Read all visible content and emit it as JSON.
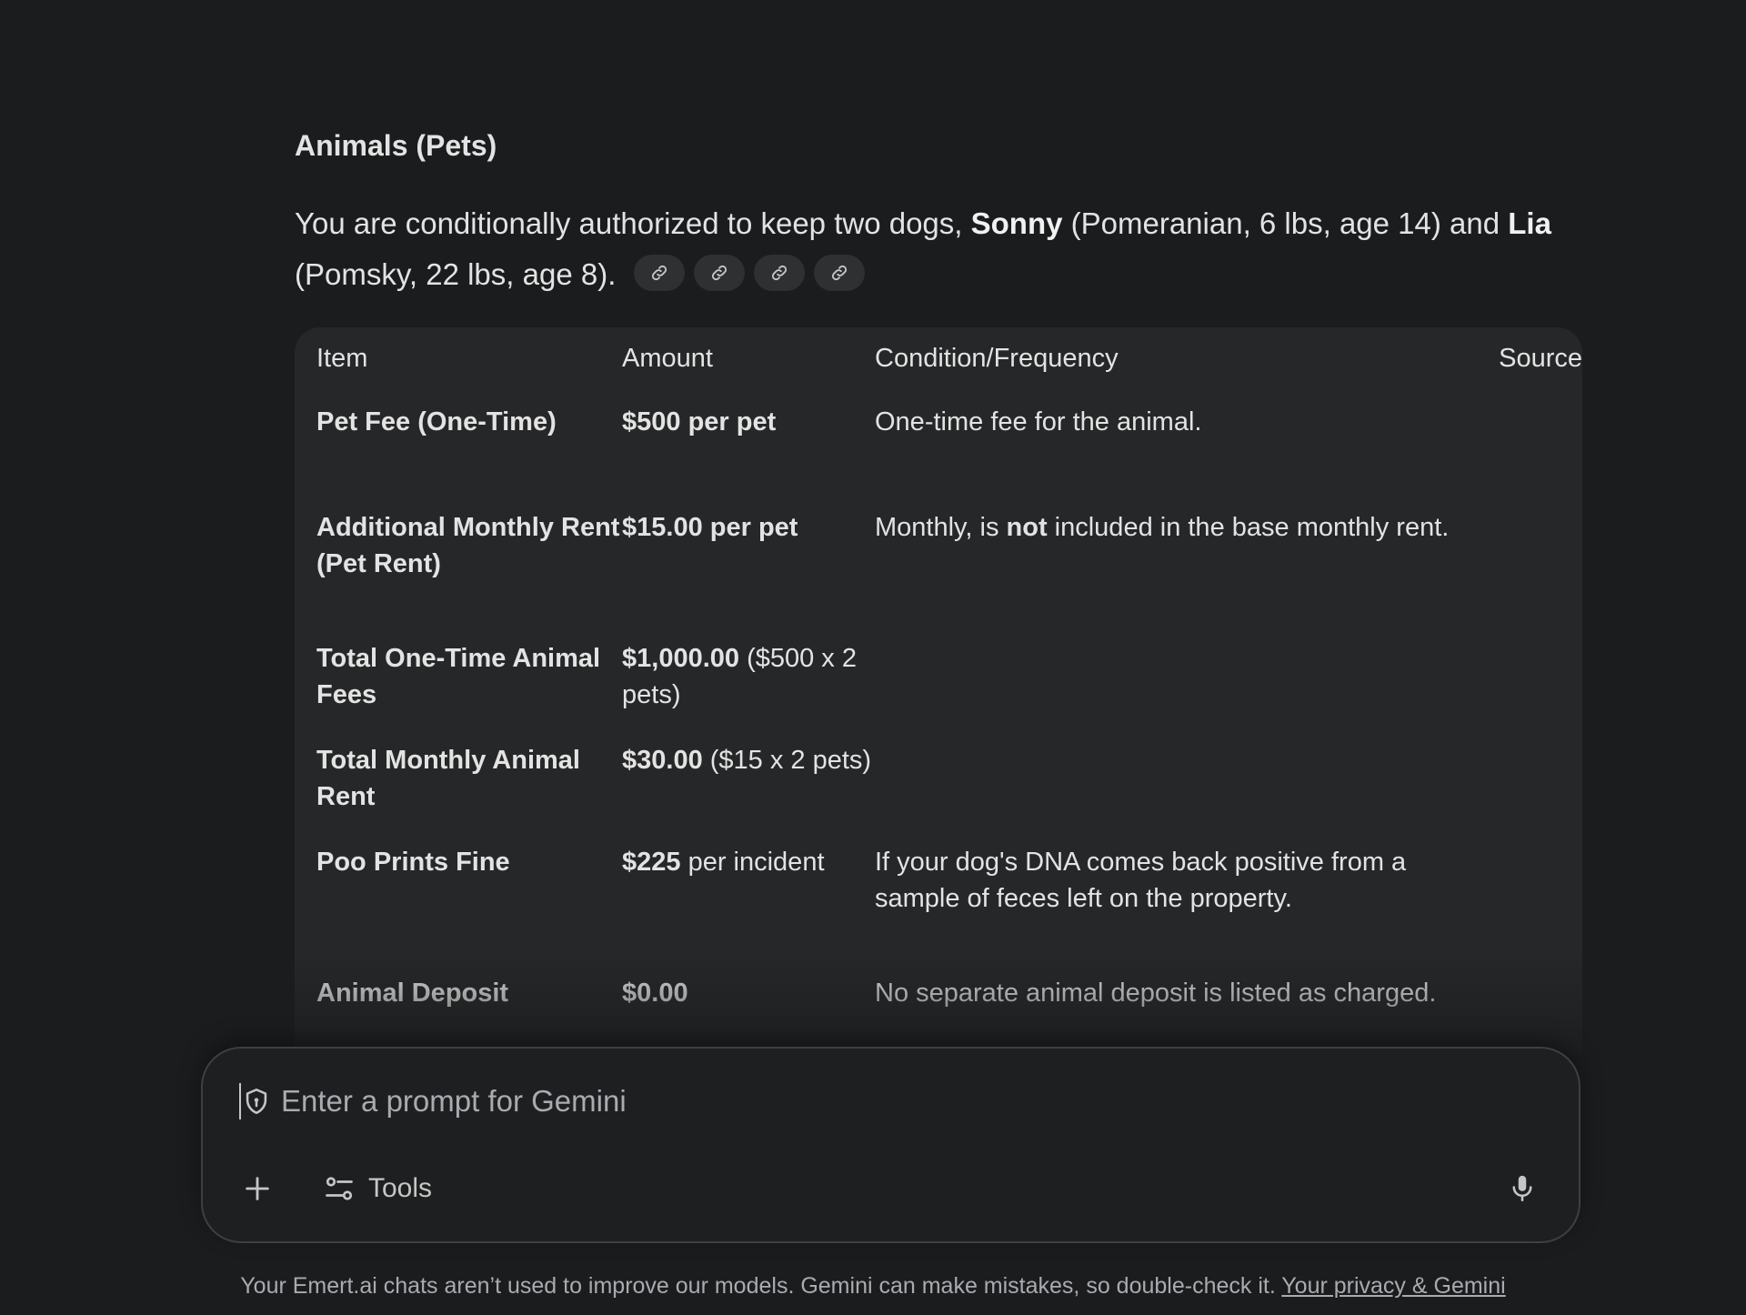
{
  "response": {
    "section_title": "Animals (Pets)",
    "intro": {
      "part1": "You are conditionally authorized to keep two dogs, ",
      "name1": "Sonny",
      "part2": " (Pomeranian, 6 lbs, age 14) and ",
      "name2": "Lia",
      "part3": " (Pomsky, 22 lbs, age 8).",
      "source_chips": [
        "link-icon",
        "link-icon",
        "link-icon",
        "link-icon"
      ]
    },
    "table": {
      "headers": [
        "Item",
        "Amount",
        "Condition/Frequency",
        "Source"
      ],
      "rows": [
        {
          "item": "Pet Fee (One-Time)",
          "amount_bold": "$500 per pet",
          "amount_rest": "",
          "cond_pre": "One-time fee for the animal.",
          "cond_bold": "",
          "cond_post": ""
        },
        {
          "item": "Additional Monthly Rent (Pet Rent)",
          "amount_bold": "$15.00 per pet",
          "amount_rest": "",
          "cond_pre": "Monthly, is ",
          "cond_bold": "not",
          "cond_post": " included in the base monthly rent."
        },
        {
          "item": "Total One-Time Animal Fees",
          "amount_bold": "$1,000.00",
          "amount_rest": " ($500 x 2 pets)",
          "cond_pre": "",
          "cond_bold": "",
          "cond_post": ""
        },
        {
          "item": "Total Monthly Animal Rent",
          "amount_bold": "$30.00",
          "amount_rest": " ($15 x 2 pets)",
          "cond_pre": "",
          "cond_bold": "",
          "cond_post": ""
        },
        {
          "item": "Poo Prints Fine",
          "amount_bold": "$225",
          "amount_rest": " per incident",
          "cond_pre": "If your dog's DNA comes back positive from a sample of feces left on the property.",
          "cond_bold": "",
          "cond_post": ""
        },
        {
          "item": "Animal Deposit",
          "amount_bold": "$0.00",
          "amount_rest": "",
          "cond_pre": "No separate animal deposit is listed as charged.",
          "cond_bold": "",
          "cond_post": ""
        }
      ]
    }
  },
  "prompt": {
    "placeholder": "Enter a prompt for Gemini",
    "value": "",
    "tools_label": "Tools",
    "icons": [
      "shield-icon",
      "plus-icon",
      "tools-icon",
      "mic-icon"
    ]
  },
  "footer": {
    "disclaimer": "Your Emert.ai chats aren’t used to improve our models. Gemini can make mistakes, so double-check it. ",
    "privacy_link": "Your privacy & Gemini"
  },
  "colors": {
    "background": "#1b1c1d",
    "table_background": "#262728",
    "text": "#e3e3e3",
    "muted_text": "#a8abb0",
    "chip_background": "#2f3032"
  }
}
